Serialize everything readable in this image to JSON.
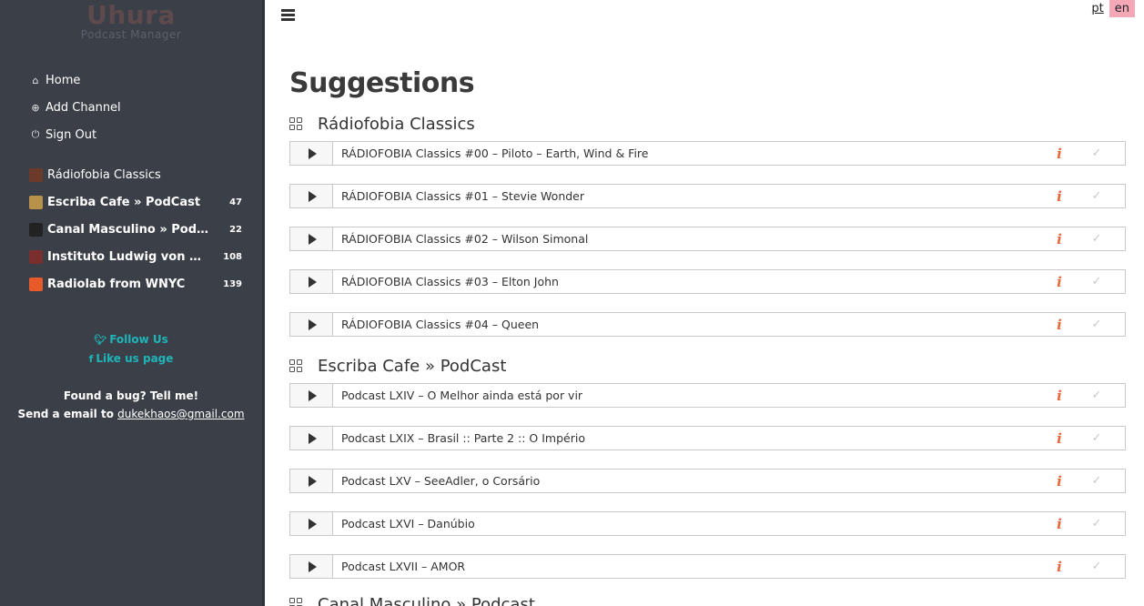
{
  "app": {
    "title": "Uhura",
    "subtitle": "Podcast Manager"
  },
  "menu": [
    {
      "label": "Home",
      "icon": "home-icon",
      "glyph": "⌂"
    },
    {
      "label": "Add Channel",
      "icon": "add-channel-icon",
      "glyph": "⊕"
    },
    {
      "label": "Sign Out",
      "icon": "power-icon",
      "glyph": "⏻"
    }
  ],
  "channels": [
    {
      "name": "Rádiofobia Classics",
      "count": "",
      "unread": false,
      "thumb_color": "#6b3a2a"
    },
    {
      "name": "Escriba Cafe » PodCast",
      "count": "47",
      "unread": true,
      "thumb_color": "#b8924a"
    },
    {
      "name": "Canal Masculino » Podcast",
      "count": "22",
      "unread": true,
      "thumb_color": "#222222"
    },
    {
      "name": "Instituto Ludwig von Mises Brasil",
      "count": "108",
      "unread": true,
      "thumb_color": "#7a2e2e"
    },
    {
      "name": "Radiolab from WNYC",
      "count": "139",
      "unread": true,
      "thumb_color": "#e85a2a"
    }
  ],
  "social": {
    "twitter": "Follow Us",
    "facebook": "Like us page"
  },
  "bug": {
    "line1": "Found a bug? Tell me!",
    "line2": "Send a email to",
    "email": "dukekhaos@gmail.com"
  },
  "lang": {
    "pt": "pt",
    "en": "en",
    "active": "en"
  },
  "page_title": "Suggestions",
  "sections": [
    {
      "title": "Rádiofobia Classics",
      "episodes": [
        "RÁDIOFOBIA Classics #00 – Piloto – Earth, Wind & Fire",
        "RÁDIOFOBIA Classics #01 – Stevie Wonder",
        "RÁDIOFOBIA Classics #02 – Wilson Simonal",
        "RÁDIOFOBIA Classics #03 – Elton John",
        "RÁDIOFOBIA Classics #04 – Queen"
      ]
    },
    {
      "title": "Escriba Cafe » PodCast",
      "episodes": [
        "Podcast LXIV – O Melhor ainda está por vir",
        "Podcast LXIX – Brasil :: Parte 2 :: O Império",
        "Podcast LXV – SeeAdler, o Corsário",
        "Podcast LXVI – Danúbio",
        "Podcast LXVII – AMOR"
      ]
    },
    {
      "title": "Canal Masculino » Podcast",
      "episodes": []
    }
  ],
  "icons": {
    "info": "i",
    "check": "✓"
  },
  "colors": {
    "sidebar_bg": "#3b3f48",
    "accent": "#1fb5b8",
    "info": "#e8683a",
    "lang_active": "#f3a7b7"
  }
}
